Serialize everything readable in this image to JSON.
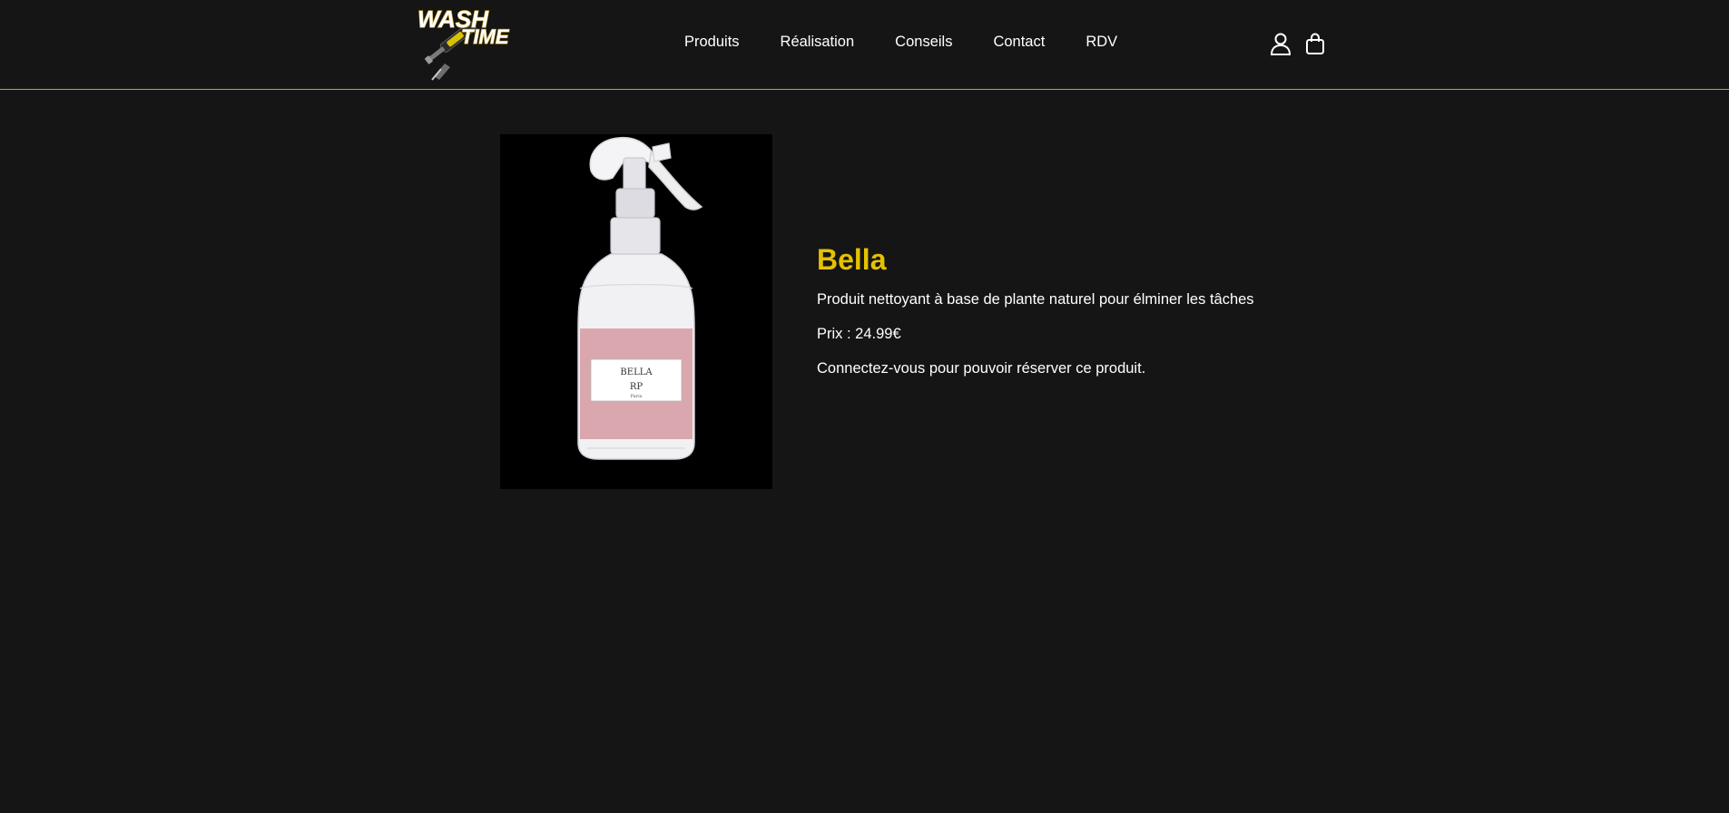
{
  "brand": {
    "logo_line1": "WASH",
    "logo_line2": "TIME",
    "accent_color": "#e5c100",
    "border_color": "#c9a227",
    "background_color": "#151515"
  },
  "nav": {
    "items": [
      {
        "label": "Produits"
      },
      {
        "label": "Réalisation"
      },
      {
        "label": "Conseils"
      },
      {
        "label": "Contact"
      },
      {
        "label": "RDV"
      }
    ]
  },
  "header_icons": {
    "account": "user-icon",
    "cart": "shopping-bag-icon"
  },
  "product": {
    "image_label": "BELLA",
    "image_brand": "RP",
    "image_city": "Paris",
    "name": "Bella",
    "description": "Produit nettoyant à base de plante naturel pour élminer les tâches",
    "price_line": "Prix : 24.99€",
    "login_message": "Connectez-vous pour pouvoir réserver ce produit."
  }
}
